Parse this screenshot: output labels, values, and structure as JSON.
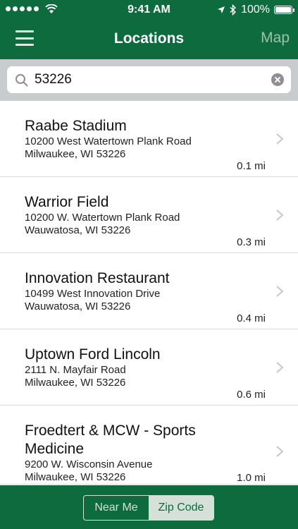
{
  "status": {
    "time": "9:41 AM",
    "battery": "100%"
  },
  "nav": {
    "title": "Locations",
    "map_label": "Map"
  },
  "search": {
    "value": "53226",
    "placeholder": ""
  },
  "locations": [
    {
      "name": "Raabe Stadium",
      "address1": "10200 West Watertown Plank Road",
      "address2": "Milwaukee, WI 53226",
      "distance": "0.1 mi"
    },
    {
      "name": "Warrior Field",
      "address1": "10200 W. Watertown Plank Road",
      "address2": "Wauwatosa, WI 53226",
      "distance": "0.3 mi"
    },
    {
      "name": "Innovation Restaurant",
      "address1": "10499 West Innovation Drive",
      "address2": "Wauwatosa, WI 53226",
      "distance": "0.4 mi"
    },
    {
      "name": "Uptown Ford Lincoln",
      "address1": "2111 N. Mayfair Road",
      "address2": "Milwaukee, WI 53226",
      "distance": "0.6 mi"
    },
    {
      "name": "Froedtert & MCW - Sports Medicine",
      "address1": "9200 W. Wisconsin Avenue",
      "address2": "Milwaukee, WI 53226",
      "distance": "1.0 mi"
    }
  ],
  "toggle": {
    "near_me": "Near Me",
    "zip_code": "Zip Code",
    "selected": "zip_code"
  },
  "colors": {
    "brand_green": "#0e6b3d",
    "search_bg": "#c9ccce"
  }
}
